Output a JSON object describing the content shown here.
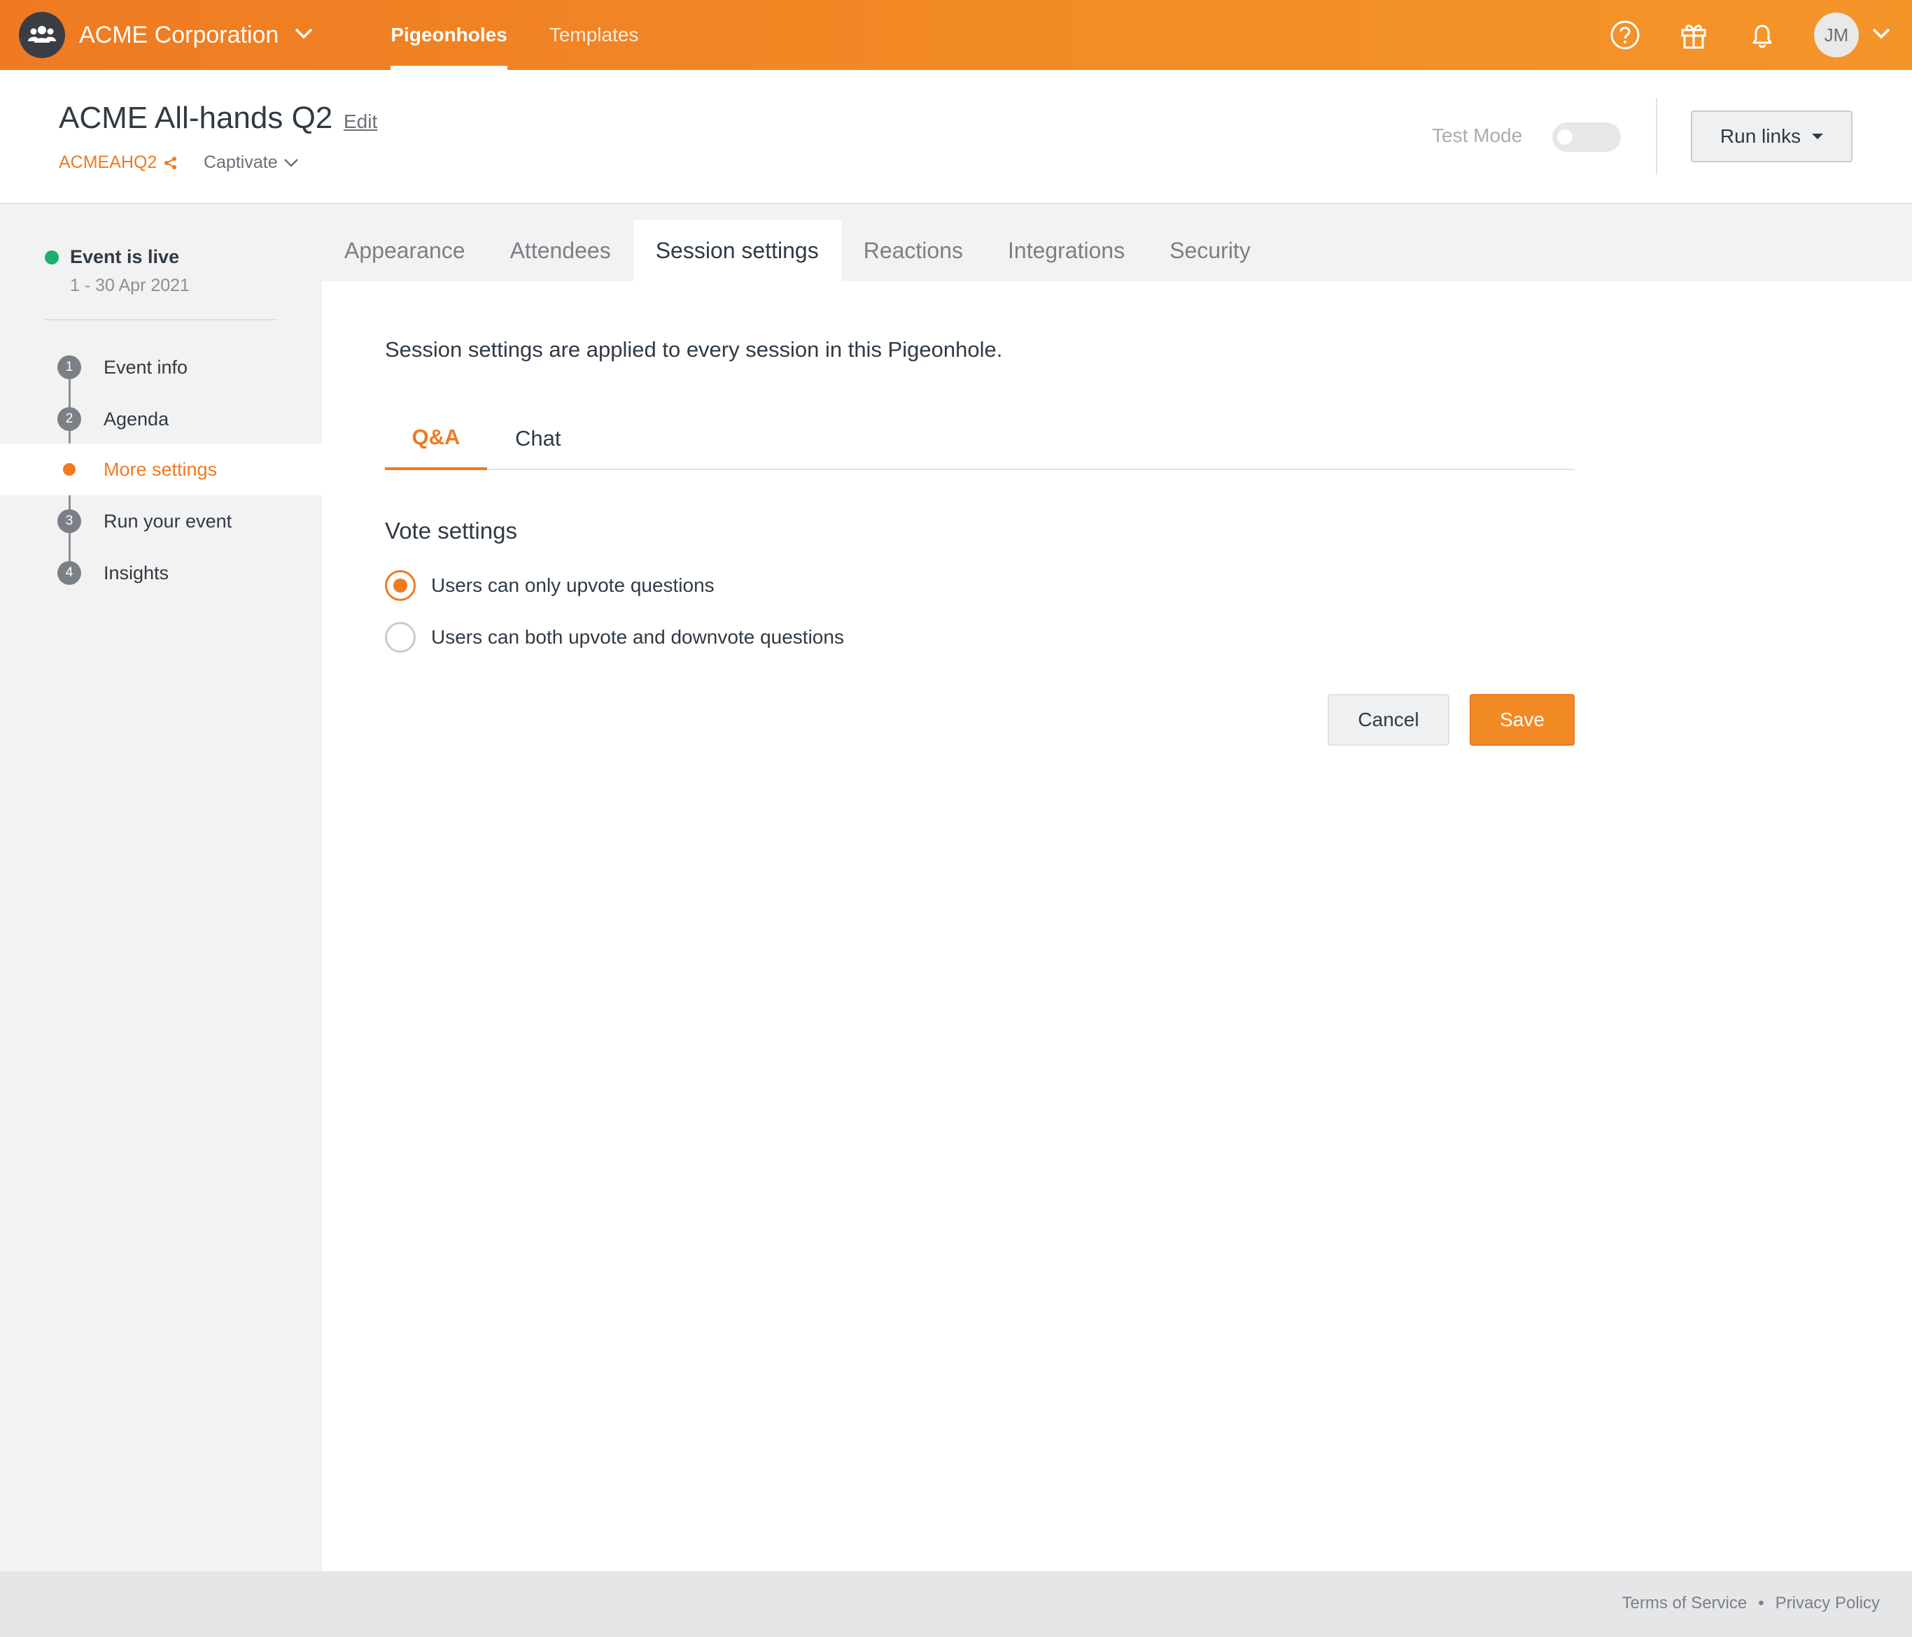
{
  "topbar": {
    "org_name": "ACME Corporation",
    "nav": [
      "Pigeonholes",
      "Templates"
    ],
    "active_nav": "Pigeonholes",
    "avatar_initials": "JM",
    "icons": [
      "people-icon",
      "help-icon",
      "gift-icon",
      "bell-icon",
      "chevron-down-icon"
    ]
  },
  "header": {
    "title": "ACME All-hands Q2",
    "edit_label": "Edit",
    "event_code": "ACMEAHQ2",
    "plan": "Captivate",
    "test_mode_label": "Test Mode",
    "test_mode_on": false,
    "run_links_label": "Run links"
  },
  "sidebar": {
    "status": "Event is live",
    "dates": "1 - 30 Apr 2021",
    "steps": [
      {
        "num": "1",
        "label": "Event info"
      },
      {
        "num": "2",
        "label": "Agenda"
      },
      {
        "num": "",
        "label": "More settings"
      },
      {
        "num": "3",
        "label": "Run your event"
      },
      {
        "num": "4",
        "label": "Insights"
      }
    ],
    "active_step": "More settings"
  },
  "tabs": [
    "Appearance",
    "Attendees",
    "Session settings",
    "Reactions",
    "Integrations",
    "Security"
  ],
  "active_tab": "Session settings",
  "main": {
    "intro": "Session settings are applied to every session in this Pigeonhole.",
    "subtabs": [
      "Q&A",
      "Chat"
    ],
    "active_subtab": "Q&A",
    "section_title": "Vote settings",
    "options": [
      {
        "label": "Users can only upvote questions",
        "checked": true
      },
      {
        "label": "Users can both upvote and downvote questions",
        "checked": false
      }
    ],
    "cancel_label": "Cancel",
    "save_label": "Save"
  },
  "footer": {
    "terms": "Terms of Service",
    "separator": "•",
    "privacy": "Privacy Policy"
  },
  "colors": {
    "brand_orange": "#ef7a22",
    "live_green": "#1fae6d",
    "text_dark": "#2f3a45"
  }
}
